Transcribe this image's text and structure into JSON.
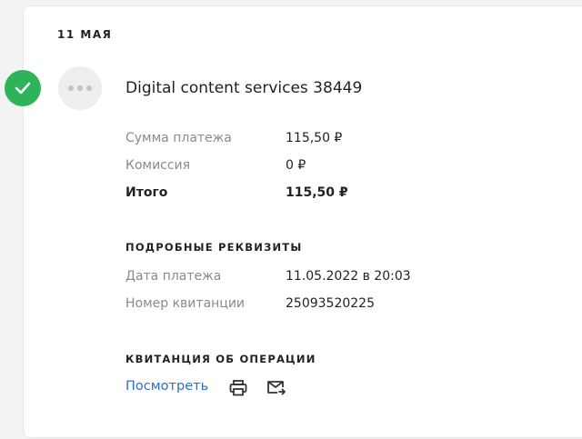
{
  "date_header": "11 МАЯ",
  "merchant": {
    "name": "Digital content services 38449"
  },
  "amounts": {
    "payment": {
      "label": "Сумма платежа",
      "value": "115,50 ₽"
    },
    "commission": {
      "label": "Комиссия",
      "value": "0 ₽"
    },
    "total": {
      "label": "Итого",
      "value": "115,50 ₽"
    }
  },
  "details": {
    "title": "ПОДРОБНЫЕ РЕКВИЗИТЫ",
    "payment_date": {
      "label": "Дата платежа",
      "value": "11.05.2022 в 20:03"
    },
    "receipt_number": {
      "label": "Номер квитанции",
      "value": "25093520225"
    }
  },
  "receipt": {
    "title": "КВИТАНЦИЯ ОБ ОПЕРАЦИИ",
    "view_link": "Посмотреть",
    "icons": [
      "print-icon",
      "mail-send-icon"
    ]
  },
  "colors": {
    "success": "#2fb358",
    "link": "#2b6fc9"
  }
}
